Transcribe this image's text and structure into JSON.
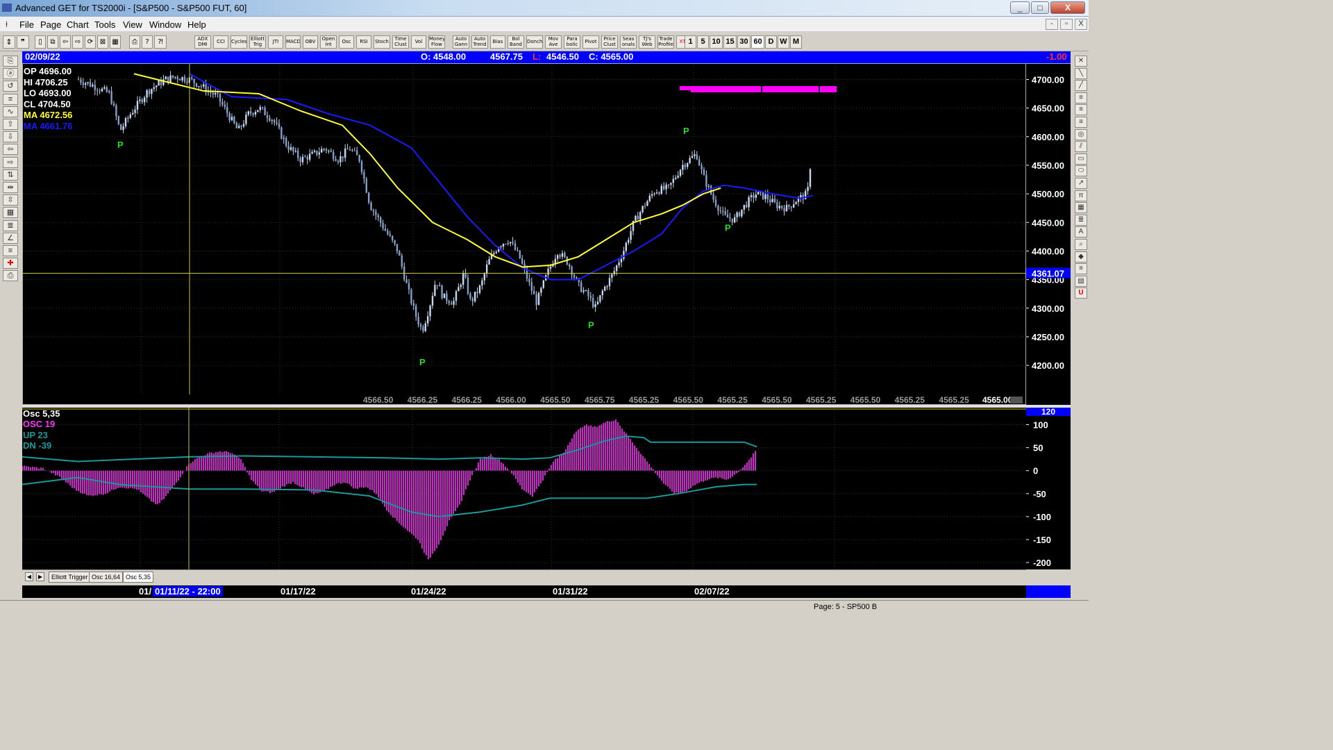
{
  "window": {
    "title": "Advanced GET for TS2000i - [S&P500 - S&P500 FUT, 60]",
    "min": "_",
    "max": "□",
    "close": "X"
  },
  "menu": {
    "items": [
      "File",
      "Page",
      "Chart",
      "Tools",
      "View",
      "Window",
      "Help"
    ],
    "mdi_buttons": [
      "-",
      "▫",
      "X"
    ]
  },
  "toolbar": {
    "indicators": [
      "ADX DMI",
      "CCI",
      "Cycles",
      "Elliott Trig",
      "JTI",
      "MACD",
      "OBV",
      "Open Int",
      "Osc",
      "RSI",
      "Stoch",
      "Time Clust",
      "Vol",
      "Money Flow",
      "Auto Gann",
      "Auto Trend",
      "Bias",
      "Bol Band",
      "Donch",
      "Mov Ave",
      "Para bolic",
      "Pivot",
      "Price Clust",
      "Seas onals",
      "TJ's Web",
      "Trade Profile",
      "XTL"
    ],
    "intervals": [
      "1",
      "5",
      "10",
      "15",
      "30",
      "60",
      "D",
      "W",
      "M"
    ],
    "active_interval": "60"
  },
  "infobar": {
    "date": "02/09/22",
    "open": "O: 4548.00",
    "high": "4567.75",
    "low_label": "L:",
    "low": "4546.50",
    "close": "C: 4565.00",
    "change": "-1.00"
  },
  "legend": {
    "op": "OP  4696.00",
    "hi": "HI   4706.25",
    "lo": "LO  4693.00",
    "cl": "CL  4704.50",
    "ma1": "MA  4672.56",
    "ma2": "MA  4661.76"
  },
  "osc_legend": {
    "title": "Osc 5,35",
    "osc": "OSC 19",
    "up": "UP   23",
    "dn": "DN   -39"
  },
  "price_axis": {
    "ticks": [
      "4700.00",
      "4650.00",
      "4600.00",
      "4550.00",
      "4500.00",
      "4450.00",
      "4400.00",
      "4350.00",
      "4300.00",
      "4250.00",
      "4200.00"
    ],
    "cursor_label": "4361.07"
  },
  "osc_axis": {
    "ticks": [
      "100",
      "50",
      "0",
      "-50",
      "-100",
      "-150",
      "-200"
    ],
    "top_label": "120"
  },
  "bottom_prices": [
    "4566.50",
    "4566.25",
    "4566.25",
    "4566.00",
    "4565.50",
    "4565.75",
    "4565.25",
    "4565.50",
    "4565.25",
    "4565.50",
    "4565.25",
    "4565.50",
    "4565.25",
    "4565.25"
  ],
  "last_price": "4565.00",
  "pivot_label": "P",
  "tabs": [
    "Elliott Trigger",
    "Osc 16,64",
    "Osc 5,35"
  ],
  "dates": {
    "cursor": "01/11/22 - 22:00",
    "clipped": "01/",
    "d1": "01/17/22",
    "d2": "01/24/22",
    "d3": "01/31/22",
    "d4": "02/07/22"
  },
  "status": {
    "page": "Page: 5 - SP500 B"
  },
  "colors": {
    "bull": "#c8d8f0",
    "ma_fast": "#ffff33",
    "ma_slow": "#1a1aff",
    "osc": "#ff33ff",
    "band": "#1a9a9a",
    "pivot": "#22dd22",
    "bg": "#000000",
    "accent": "#0000ff"
  },
  "chart_data": {
    "type": "candlestick",
    "y_range": [
      4160,
      4720
    ],
    "path_anchors": [
      [
        0,
        4700
      ],
      [
        20,
        4690
      ],
      [
        45,
        4675
      ],
      [
        60,
        4610
      ],
      [
        75,
        4640
      ],
      [
        100,
        4680
      ],
      [
        125,
        4700
      ],
      [
        140,
        4705
      ],
      [
        160,
        4700
      ],
      [
        175,
        4690
      ],
      [
        200,
        4670
      ],
      [
        215,
        4640
      ],
      [
        230,
        4610
      ],
      [
        245,
        4640
      ],
      [
        260,
        4650
      ],
      [
        280,
        4630
      ],
      [
        300,
        4585
      ],
      [
        320,
        4560
      ],
      [
        340,
        4570
      ],
      [
        355,
        4580
      ],
      [
        375,
        4560
      ],
      [
        390,
        4580
      ],
      [
        405,
        4560
      ],
      [
        420,
        4480
      ],
      [
        440,
        4440
      ],
      [
        460,
        4400
      ],
      [
        475,
        4330
      ],
      [
        485,
        4290
      ],
      [
        495,
        4260
      ],
      [
        505,
        4300
      ],
      [
        515,
        4350
      ],
      [
        525,
        4320
      ],
      [
        540,
        4310
      ],
      [
        555,
        4360
      ],
      [
        565,
        4310
      ],
      [
        580,
        4340
      ],
      [
        590,
        4380
      ],
      [
        605,
        4410
      ],
      [
        620,
        4420
      ],
      [
        635,
        4390
      ],
      [
        650,
        4340
      ],
      [
        660,
        4310
      ],
      [
        675,
        4360
      ],
      [
        690,
        4400
      ],
      [
        705,
        4380
      ],
      [
        720,
        4340
      ],
      [
        735,
        4320
      ],
      [
        745,
        4300
      ],
      [
        755,
        4330
      ],
      [
        770,
        4360
      ],
      [
        785,
        4400
      ],
      [
        800,
        4450
      ],
      [
        815,
        4480
      ],
      [
        830,
        4505
      ],
      [
        850,
        4510
      ],
      [
        870,
        4550
      ],
      [
        890,
        4570
      ],
      [
        900,
        4530
      ],
      [
        915,
        4490
      ],
      [
        930,
        4460
      ],
      [
        945,
        4455
      ],
      [
        960,
        4480
      ],
      [
        975,
        4500
      ],
      [
        990,
        4495
      ],
      [
        1005,
        4480
      ],
      [
        1020,
        4475
      ],
      [
        1035,
        4490
      ],
      [
        1050,
        4500
      ],
      [
        1055,
        4560
      ]
    ],
    "ma_fast": [
      [
        80,
        4710
      ],
      [
        180,
        4680
      ],
      [
        260,
        4675
      ],
      [
        320,
        4645
      ],
      [
        380,
        4620
      ],
      [
        420,
        4570
      ],
      [
        460,
        4510
      ],
      [
        510,
        4450
      ],
      [
        560,
        4420
      ],
      [
        600,
        4390
      ],
      [
        640,
        4372
      ],
      [
        680,
        4375
      ],
      [
        720,
        4390
      ],
      [
        760,
        4420
      ],
      [
        800,
        4450
      ],
      [
        840,
        4465
      ],
      [
        870,
        4480
      ],
      [
        900,
        4500
      ],
      [
        925,
        4510
      ]
    ],
    "ma_slow": [
      [
        160,
        4710
      ],
      [
        220,
        4670
      ],
      [
        300,
        4665
      ],
      [
        360,
        4640
      ],
      [
        420,
        4620
      ],
      [
        480,
        4580
      ],
      [
        520,
        4520
      ],
      [
        560,
        4460
      ],
      [
        600,
        4410
      ],
      [
        640,
        4370
      ],
      [
        680,
        4350
      ],
      [
        720,
        4350
      ],
      [
        760,
        4375
      ],
      [
        800,
        4400
      ],
      [
        840,
        4430
      ],
      [
        870,
        4475
      ],
      [
        900,
        4505
      ],
      [
        930,
        4515
      ],
      [
        960,
        4510
      ],
      [
        1000,
        4500
      ],
      [
        1040,
        4492
      ],
      [
        1058,
        4497
      ]
    ],
    "pivots": [
      {
        "x": 60,
        "y": 4585,
        "dir": "low"
      },
      {
        "x": 495,
        "y": 4205,
        "dir": "low"
      },
      {
        "x": 738,
        "y": 4270,
        "dir": "low"
      },
      {
        "x": 875,
        "y": 4600,
        "dir": "high"
      },
      {
        "x": 935,
        "y": 4440,
        "dir": "low"
      }
    ],
    "osc_anchors": [
      [
        0,
        10
      ],
      [
        30,
        5
      ],
      [
        55,
        -15
      ],
      [
        75,
        -40
      ],
      [
        95,
        -55
      ],
      [
        120,
        -50
      ],
      [
        140,
        -35
      ],
      [
        165,
        -40
      ],
      [
        185,
        -65
      ],
      [
        195,
        -75
      ],
      [
        205,
        -60
      ],
      [
        225,
        -20
      ],
      [
        240,
        15
      ],
      [
        255,
        30
      ],
      [
        270,
        38
      ],
      [
        285,
        42
      ],
      [
        300,
        40
      ],
      [
        315,
        25
      ],
      [
        330,
        -20
      ],
      [
        345,
        -45
      ],
      [
        360,
        -48
      ],
      [
        375,
        -35
      ],
      [
        390,
        -25
      ],
      [
        405,
        -38
      ],
      [
        420,
        -52
      ],
      [
        435,
        -45
      ],
      [
        450,
        -30
      ],
      [
        465,
        -25
      ],
      [
        480,
        -40
      ],
      [
        495,
        -35
      ],
      [
        510,
        -50
      ],
      [
        525,
        -85
      ],
      [
        540,
        -110
      ],
      [
        555,
        -130
      ],
      [
        570,
        -150
      ],
      [
        585,
        -195
      ],
      [
        600,
        -160
      ],
      [
        615,
        -110
      ],
      [
        630,
        -75
      ],
      [
        645,
        -20
      ],
      [
        660,
        25
      ],
      [
        675,
        35
      ],
      [
        690,
        20
      ],
      [
        705,
        -5
      ],
      [
        720,
        -40
      ],
      [
        735,
        -55
      ],
      [
        750,
        -20
      ],
      [
        765,
        20
      ],
      [
        780,
        40
      ],
      [
        795,
        80
      ],
      [
        810,
        100
      ],
      [
        825,
        95
      ],
      [
        840,
        105
      ],
      [
        855,
        112
      ],
      [
        865,
        90
      ],
      [
        880,
        60
      ],
      [
        895,
        30
      ],
      [
        910,
        0
      ],
      [
        925,
        -30
      ],
      [
        940,
        -50
      ],
      [
        955,
        -45
      ],
      [
        970,
        -30
      ],
      [
        985,
        -20
      ],
      [
        1000,
        -15
      ],
      [
        1015,
        -20
      ],
      [
        1030,
        -5
      ],
      [
        1045,
        20
      ],
      [
        1058,
        45
      ]
    ],
    "up_band": [
      [
        0,
        30
      ],
      [
        80,
        20
      ],
      [
        160,
        25
      ],
      [
        240,
        30
      ],
      [
        320,
        32
      ],
      [
        420,
        30
      ],
      [
        520,
        28
      ],
      [
        600,
        25
      ],
      [
        660,
        28
      ],
      [
        720,
        25
      ],
      [
        760,
        28
      ],
      [
        800,
        45
      ],
      [
        840,
        65
      ],
      [
        870,
        75
      ],
      [
        895,
        72
      ],
      [
        905,
        62
      ],
      [
        960,
        62
      ],
      [
        1040,
        62
      ],
      [
        1058,
        52
      ]
    ],
    "dn_band": [
      [
        0,
        -30
      ],
      [
        80,
        -15
      ],
      [
        140,
        -30
      ],
      [
        240,
        -40
      ],
      [
        320,
        -40
      ],
      [
        420,
        -42
      ],
      [
        500,
        -55
      ],
      [
        560,
        -90
      ],
      [
        600,
        -100
      ],
      [
        660,
        -90
      ],
      [
        720,
        -75
      ],
      [
        760,
        -60
      ],
      [
        800,
        -60
      ],
      [
        900,
        -60
      ],
      [
        945,
        -50
      ],
      [
        1000,
        -35
      ],
      [
        1040,
        -30
      ],
      [
        1058,
        -30
      ]
    ],
    "osc_range": [
      -215,
      125
    ]
  }
}
